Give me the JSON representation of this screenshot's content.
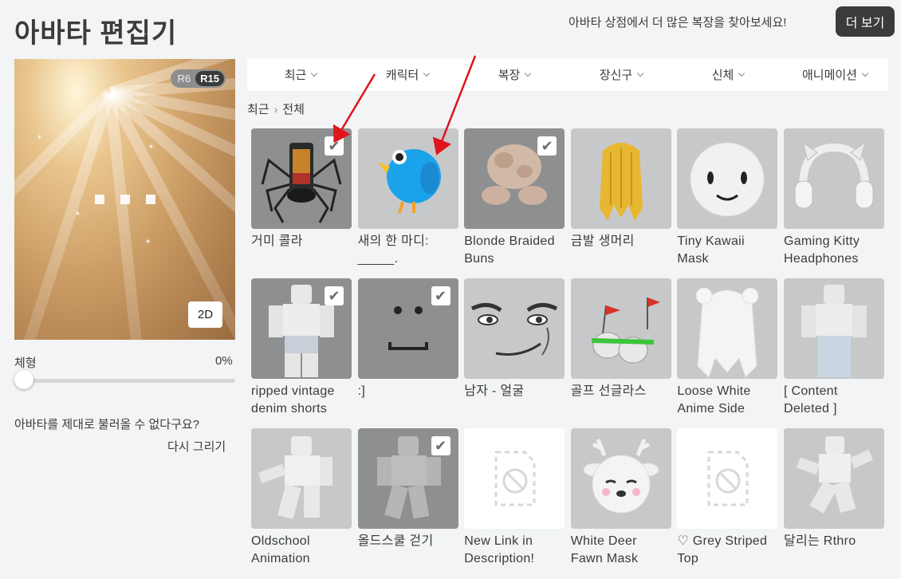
{
  "header": {
    "title": "아바타 편집기",
    "shop_text": "아바타 상점에서 더 많은 복장을 찾아보세요!",
    "more_button": "더 보기"
  },
  "preview": {
    "rig_r6": "R6",
    "rig_r15": "R15",
    "view_2d": "2D"
  },
  "body_type": {
    "label": "체형",
    "value": "0%",
    "level": 0
  },
  "reload": {
    "question": "아바타를 제대로 불러올 수 없다구요?",
    "redraw": "다시 그리기"
  },
  "tabs": [
    "최근",
    "캐릭터",
    "복장",
    "장신구",
    "신체",
    "애니메이션"
  ],
  "breadcrumb": [
    "최근",
    "전체"
  ],
  "items": [
    {
      "name": "거미 콜라",
      "checked": true,
      "bg": "dark",
      "art": "spider"
    },
    {
      "name": "새의 한 마디: _____.",
      "checked": false,
      "bg": "light",
      "art": "bird"
    },
    {
      "name": "Blonde Braided Buns",
      "checked": true,
      "bg": "dark",
      "art": "buns"
    },
    {
      "name": "금발 생머리",
      "checked": false,
      "bg": "light",
      "art": "hair"
    },
    {
      "name": "Tiny Kawaii Mask",
      "checked": false,
      "bg": "light",
      "art": "mask"
    },
    {
      "name": "Gaming Kitty Headphones",
      "checked": false,
      "bg": "light",
      "art": "headphones"
    },
    {
      "name": "ripped vintage denim shorts",
      "checked": true,
      "bg": "dark",
      "art": "figure"
    },
    {
      "name": ":]",
      "checked": true,
      "bg": "dark",
      "art": "face"
    },
    {
      "name": "남자 - 얼굴",
      "checked": false,
      "bg": "light",
      "art": "manface"
    },
    {
      "name": "골프 선글라스",
      "checked": false,
      "bg": "light",
      "art": "golf"
    },
    {
      "name": "Loose White Anime Side",
      "checked": false,
      "bg": "light",
      "art": "whitehair"
    },
    {
      "name": "[ Content Deleted ]",
      "checked": false,
      "bg": "light",
      "art": "figure2"
    },
    {
      "name": "Oldschool Animation",
      "checked": false,
      "bg": "light",
      "art": "anim1"
    },
    {
      "name": "올드스쿨 걷기",
      "checked": true,
      "bg": "dark",
      "art": "anim2"
    },
    {
      "name": "New Link in Description!",
      "checked": false,
      "bg": "white",
      "art": "blocked"
    },
    {
      "name": "White Deer Fawn Mask",
      "checked": false,
      "bg": "light",
      "art": "deer"
    },
    {
      "name": "♡ Grey Striped Top",
      "checked": false,
      "bg": "white",
      "art": "blocked"
    },
    {
      "name": "달리는 Rthro",
      "checked": false,
      "bg": "light",
      "art": "anim3"
    }
  ],
  "check_glyph": "✔",
  "colors": {
    "accent_dark": "#393b3d",
    "arrow": "#e0141b"
  }
}
